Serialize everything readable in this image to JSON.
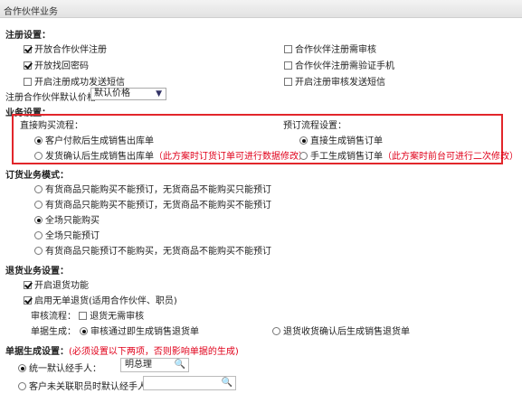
{
  "window_title": "合作伙伴业务",
  "registration": {
    "heading": "注册设置：",
    "options_left": [
      {
        "label": "开放合作伙伴注册",
        "checked": true
      },
      {
        "label": "开放找回密码",
        "checked": true
      },
      {
        "label": "开启注册成功发送短信",
        "checked": false
      }
    ],
    "options_right": [
      {
        "label": "合作伙伴注册需审核",
        "checked": false
      },
      {
        "label": "合作伙伴注册需验证手机",
        "checked": false
      },
      {
        "label": "开启注册审核发送短信",
        "checked": false
      }
    ],
    "default_price_label": "注册合作伙伴默认价格：",
    "default_price_value": "默认价格"
  },
  "business": {
    "heading": "业务设置：",
    "direct_flow": {
      "heading": "直接购买流程：",
      "options": [
        {
          "label": "客户付款后生成销售出库单",
          "note": "",
          "selected": true
        },
        {
          "label": "发货确认后生成销售出库单",
          "note": "（此方案时订货订单可进行数据修改）",
          "selected": false
        }
      ]
    },
    "preorder_flow": {
      "heading": "预订流程设置：",
      "options": [
        {
          "label": "直接生成销售订单",
          "note": "",
          "selected": true
        },
        {
          "label": "手工生成销售订单",
          "note": "（此方案时前台可进行二次修改）",
          "selected": false
        }
      ]
    }
  },
  "order_mode": {
    "heading": "订货业务模式：",
    "options": [
      {
        "label": "有货商品只能购买不能预订，无货商品不能购买只能预订",
        "selected": false
      },
      {
        "label": "有货商品只能购买不能预订，无货商品不能购买不能预订",
        "selected": false
      },
      {
        "label": "全场只能购买",
        "selected": true
      },
      {
        "label": "全场只能预订",
        "selected": false
      },
      {
        "label": "有货商品只能预订不能购买，无货商品不能购买不能预订",
        "selected": false
      }
    ]
  },
  "returns": {
    "heading": "退货业务设置：",
    "enable_return": {
      "label": "开启退货功能",
      "checked": true
    },
    "enable_no_order_return": {
      "label": "启用无单退货(适用合作伙伴、职员)",
      "checked": true
    },
    "review_flow_label": "审核流程：",
    "review_option": {
      "label": "退货无需审核",
      "checked": false
    },
    "doc_gen_label": "单据生成：",
    "doc_gen_options": [
      {
        "label": "审核通过即生成销售退货单",
        "selected": true
      },
      {
        "label": "退货收货确认后生成销售退货单",
        "selected": false
      }
    ]
  },
  "doc_generation": {
    "heading": "单据生成设置：",
    "warning": "(必须设置以下两项，否则影响单据的生成)",
    "unified_handler_label": "统一默认经手人：",
    "unified_handler_value": "明总理",
    "unlinked_handler_label": "客户未关联职员时默认经手人：",
    "unlinked_handler_value": ""
  },
  "icons": {
    "dropdown": "chevron-down-icon",
    "search": "magnifier-icon"
  },
  "colors": {
    "highlight_box": "#e2262b",
    "note_text": "#e0001a"
  }
}
